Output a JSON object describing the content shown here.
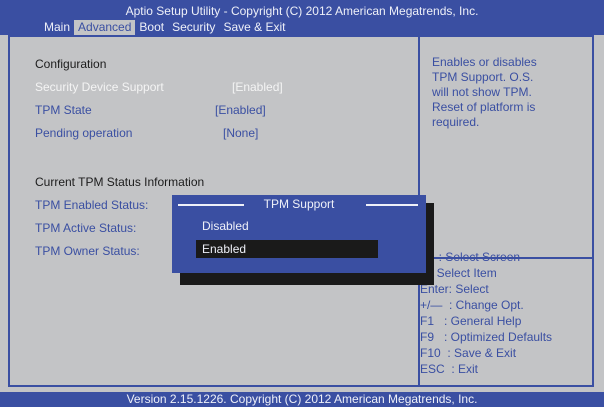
{
  "header": {
    "title": "Aptio Setup Utility - Copyright (C) 2012 American Megatrends, Inc."
  },
  "menu": [
    {
      "label": "Main"
    },
    {
      "label": "Advanced"
    },
    {
      "label": "Boot"
    },
    {
      "label": "Security"
    },
    {
      "label": "Save & Exit"
    }
  ],
  "config": {
    "heading": "Configuration",
    "items": [
      {
        "label": "Security Device Support",
        "value": "[Enabled]"
      },
      {
        "label": "TPM State",
        "value": "[Enabled]"
      },
      {
        "label": "Pending operation",
        "value": "[None]"
      }
    ],
    "status_heading": "Current TPM Status Information",
    "status": [
      {
        "label": "TPM Enabled Status:"
      },
      {
        "label": "TPM Active Status:"
      },
      {
        "label": "TPM Owner Status:"
      }
    ]
  },
  "help": {
    "lines": [
      "Enables or disables",
      "TPM Support. O.S.",
      "will not show TPM.",
      "Reset of platform is",
      "required."
    ]
  },
  "keys": [
    "←  : Select Screen",
    "   : Select Item",
    "Enter: Select",
    "+/—  : Change Opt.",
    "F1   : General Help",
    "F9   : Optimized Defaults",
    "F10  : Save & Exit",
    "ESC  : Exit"
  ],
  "popup": {
    "title": "TPM Support",
    "options": [
      {
        "label": "Disabled"
      },
      {
        "label": "Enabled"
      }
    ]
  },
  "footer": {
    "text": "Version 2.15.1226. Copyright (C) 2012 American Megatrends, Inc."
  },
  "colors": {
    "accent": "#3a4fa2",
    "background": "#c3c4c6",
    "highlight": "#1a1a1a"
  }
}
